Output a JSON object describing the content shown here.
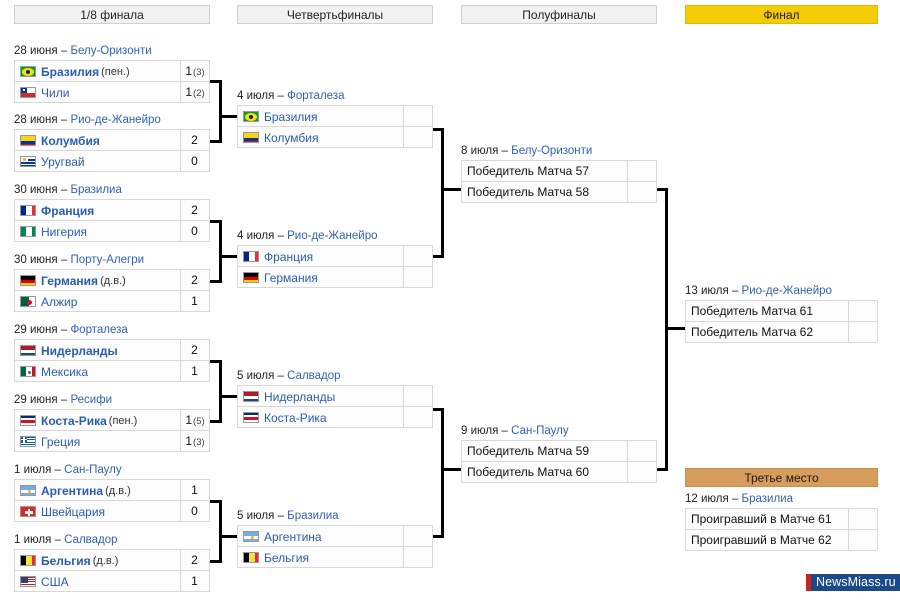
{
  "headers": [
    {
      "key": "r16",
      "label": "1/8 финала",
      "style": "plain"
    },
    {
      "key": "qf",
      "label": "Четвертьфиналы",
      "style": "plain"
    },
    {
      "key": "sf",
      "label": "Полуфиналы",
      "style": "plain"
    },
    {
      "key": "final",
      "label": "Финал",
      "style": "gold"
    },
    {
      "key": "third",
      "label": "Третье место",
      "style": "bronze"
    }
  ],
  "round16": [
    {
      "date": "28 июня",
      "dash": "–",
      "venue": "Белу-Оризонти",
      "rows": [
        {
          "team": "Бразилия",
          "note": "(пен.)",
          "score": "1",
          "pen": "(3)",
          "winner": true,
          "flag": "brazil"
        },
        {
          "team": "Чили",
          "note": "",
          "score": "1",
          "pen": "(2)",
          "winner": false,
          "flag": "chile"
        }
      ]
    },
    {
      "date": "28 июня",
      "dash": "–",
      "venue": "Рио-де-Жанейро",
      "rows": [
        {
          "team": "Колумбия",
          "note": "",
          "score": "2",
          "pen": "",
          "winner": true,
          "flag": "colombia"
        },
        {
          "team": "Уругвай",
          "note": "",
          "score": "0",
          "pen": "",
          "winner": false,
          "flag": "uruguay"
        }
      ]
    },
    {
      "date": "30 июня",
      "dash": "–",
      "venue": "Бразилиа",
      "rows": [
        {
          "team": "Франция",
          "note": "",
          "score": "2",
          "pen": "",
          "winner": true,
          "flag": "france"
        },
        {
          "team": "Нигерия",
          "note": "",
          "score": "0",
          "pen": "",
          "winner": false,
          "flag": "nigeria"
        }
      ]
    },
    {
      "date": "30 июня",
      "dash": "–",
      "venue": "Порту-Алегри",
      "rows": [
        {
          "team": "Германия",
          "note": "(д.в.)",
          "score": "2",
          "pen": "",
          "winner": true,
          "flag": "germany"
        },
        {
          "team": "Алжир",
          "note": "",
          "score": "1",
          "pen": "",
          "winner": false,
          "flag": "algeria"
        }
      ]
    },
    {
      "date": "29 июня",
      "dash": "–",
      "venue": "Форталеза",
      "rows": [
        {
          "team": "Нидерланды",
          "note": "",
          "score": "2",
          "pen": "",
          "winner": true,
          "flag": "netherlands"
        },
        {
          "team": "Мексика",
          "note": "",
          "score": "1",
          "pen": "",
          "winner": false,
          "flag": "mexico"
        }
      ]
    },
    {
      "date": "29 июня",
      "dash": "–",
      "venue": "Ресифи",
      "rows": [
        {
          "team": "Коста-Рика",
          "note": "(пен.)",
          "score": "1",
          "pen": "(5)",
          "winner": true,
          "flag": "costarica"
        },
        {
          "team": "Греция",
          "note": "",
          "score": "1",
          "pen": "(3)",
          "winner": false,
          "flag": "greece"
        }
      ]
    },
    {
      "date": "1 июля",
      "dash": "–",
      "venue": "Сан-Паулу",
      "rows": [
        {
          "team": "Аргентина",
          "note": "(д.в.)",
          "score": "1",
          "pen": "",
          "winner": true,
          "flag": "argentina"
        },
        {
          "team": "Швейцария",
          "note": "",
          "score": "0",
          "pen": "",
          "winner": false,
          "flag": "switzerland"
        }
      ]
    },
    {
      "date": "1 июля",
      "dash": "–",
      "venue": "Салвадор",
      "rows": [
        {
          "team": "Бельгия",
          "note": "(д.в.)",
          "score": "2",
          "pen": "",
          "winner": true,
          "flag": "belgium"
        },
        {
          "team": "США",
          "note": "",
          "score": "1",
          "pen": "",
          "winner": false,
          "flag": "usa"
        }
      ]
    }
  ],
  "quarterfinals": [
    {
      "date": "4 июля",
      "dash": "–",
      "venue": "Форталеза",
      "rows": [
        {
          "team": "Бразилия",
          "note": "",
          "score": "",
          "pen": "",
          "winner": false,
          "flag": "brazil"
        },
        {
          "team": "Колумбия",
          "note": "",
          "score": "",
          "pen": "",
          "winner": false,
          "flag": "colombia"
        }
      ]
    },
    {
      "date": "4 июля",
      "dash": "–",
      "venue": "Рио-де-Жанейро",
      "rows": [
        {
          "team": "Франция",
          "note": "",
          "score": "",
          "pen": "",
          "winner": false,
          "flag": "france"
        },
        {
          "team": "Германия",
          "note": "",
          "score": "",
          "pen": "",
          "winner": false,
          "flag": "germany"
        }
      ]
    },
    {
      "date": "5 июля",
      "dash": "–",
      "venue": "Салвадор",
      "rows": [
        {
          "team": "Нидерланды",
          "note": "",
          "score": "",
          "pen": "",
          "winner": false,
          "flag": "netherlands"
        },
        {
          "team": "Коста-Рика",
          "note": "",
          "score": "",
          "pen": "",
          "winner": false,
          "flag": "costarica"
        }
      ]
    },
    {
      "date": "5 июля",
      "dash": "–",
      "venue": "Бразилиа",
      "rows": [
        {
          "team": "Аргентина",
          "note": "",
          "score": "",
          "pen": "",
          "winner": false,
          "flag": "argentina"
        },
        {
          "team": "Бельгия",
          "note": "",
          "score": "",
          "pen": "",
          "winner": false,
          "flag": "belgium"
        }
      ]
    }
  ],
  "semifinals": [
    {
      "date": "8 июля",
      "dash": "–",
      "venue": "Белу-Оризонти",
      "rows": [
        {
          "team": "Победитель Матча 57",
          "note": "",
          "score": "",
          "pen": "",
          "winner": false,
          "flag": ""
        },
        {
          "team": "Победитель Матча 58",
          "note": "",
          "score": "",
          "pen": "",
          "winner": false,
          "flag": ""
        }
      ]
    },
    {
      "date": "9 июля",
      "dash": "–",
      "venue": "Сан-Паулу",
      "rows": [
        {
          "team": "Победитель Матча 59",
          "note": "",
          "score": "",
          "pen": "",
          "winner": false,
          "flag": ""
        },
        {
          "team": "Победитель Матча 60",
          "note": "",
          "score": "",
          "pen": "",
          "winner": false,
          "flag": ""
        }
      ]
    }
  ],
  "final": {
    "date": "13 июля",
    "dash": "–",
    "venue": "Рио-де-Жанейро",
    "rows": [
      {
        "team": "Победитель Матча 61",
        "note": "",
        "score": "",
        "pen": "",
        "winner": false,
        "flag": ""
      },
      {
        "team": "Победитель Матча 62",
        "note": "",
        "score": "",
        "pen": "",
        "winner": false,
        "flag": ""
      }
    ]
  },
  "third_place": {
    "date": "12 июля",
    "dash": "–",
    "venue": "Бразилиа",
    "rows": [
      {
        "team": "Проигравший в Матче 61",
        "note": "",
        "score": "",
        "pen": "",
        "winner": false,
        "flag": ""
      },
      {
        "team": "Проигравший в Матче 62",
        "note": "",
        "score": "",
        "pen": "",
        "winner": false,
        "flag": ""
      }
    ]
  },
  "logo": {
    "text": "NewsMiass.ru",
    "bar_color": "#d21f1f",
    "bg_color": "#1b4a8a"
  },
  "colors": {
    "final_header": "#f3cc06",
    "third_header": "#d69d5c",
    "header_plain": "#f2f2f2",
    "team_link": "#2a5db0",
    "venue_link": "#3062b5",
    "connector": "#000000"
  }
}
